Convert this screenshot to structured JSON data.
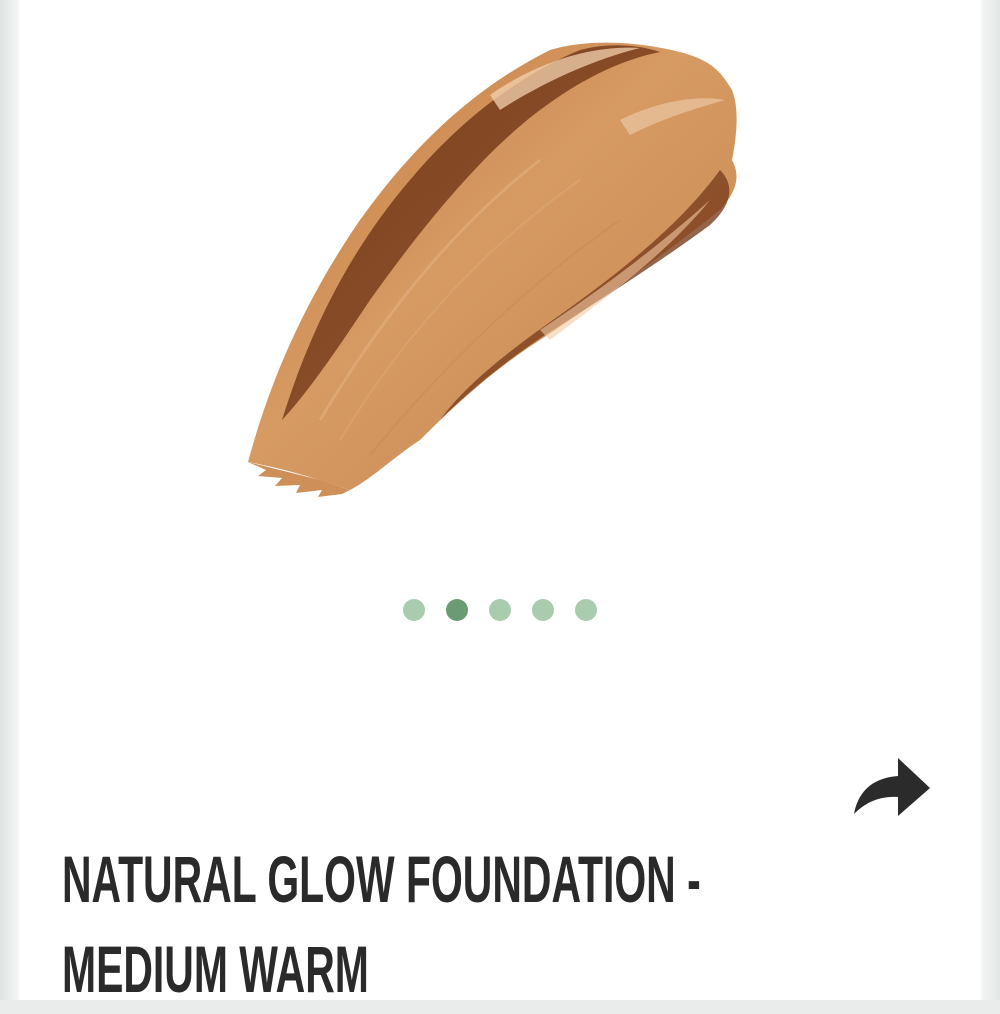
{
  "product": {
    "image_alt": "Foundation swatch",
    "title_line1": "NATURAL GLOW FOUNDATION -",
    "title_line2": "MEDIUM WARM"
  },
  "carousel": {
    "total": 5,
    "active_index": 1
  },
  "icons": {
    "share": "share-arrow-icon"
  },
  "colors": {
    "dot_inactive": "#a9ccaf",
    "dot_active": "#6b9b73",
    "swatch_light": "#d79a62",
    "swatch_dark": "#7a3e1e",
    "title": "#2a2a2a"
  }
}
